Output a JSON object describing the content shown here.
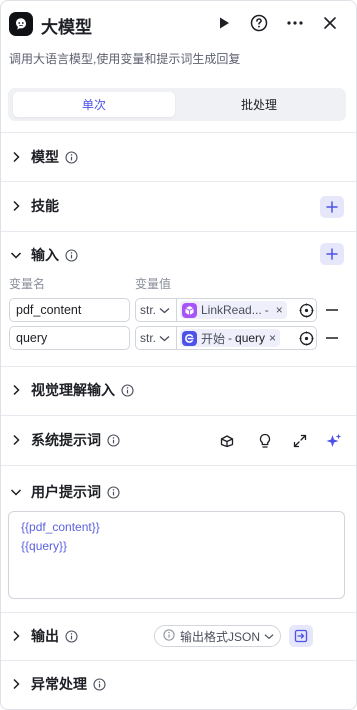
{
  "header": {
    "title": "大模型",
    "description": "调用大语言模型,使用变量和提示词生成回复"
  },
  "tabs": [
    {
      "label": "单次",
      "active": true
    },
    {
      "label": "批处理",
      "active": false
    }
  ],
  "sections": {
    "model": {
      "label": "模型"
    },
    "skills": {
      "label": "技能"
    },
    "input": {
      "label": "输入",
      "col_name": "变量名",
      "col_value": "变量值",
      "rows": [
        {
          "name": "pdf_content",
          "type": "str.",
          "source": "LinkRead...",
          "sep": "-",
          "variable": "",
          "icon": "cube-icon",
          "icon_color": "#a855f7"
        },
        {
          "name": "query",
          "type": "str.",
          "source": "开始",
          "sep": "-",
          "variable": "query",
          "icon": "start-icon",
          "icon_color": "#4d53e8"
        }
      ]
    },
    "vision_input": {
      "label": "视觉理解输入"
    },
    "system_prompt": {
      "label": "系统提示词"
    },
    "user_prompt": {
      "label": "用户提示词",
      "lines": [
        "{{pdf_content}}",
        "{{query}}"
      ]
    },
    "output": {
      "label": "输出",
      "format": "输出格式JSON"
    },
    "exception": {
      "label": "异常处理"
    }
  },
  "colors": {
    "accent": "#4d53e8",
    "accent_bg": "#e6e7fb",
    "prompt_text": "#5b61e0"
  }
}
